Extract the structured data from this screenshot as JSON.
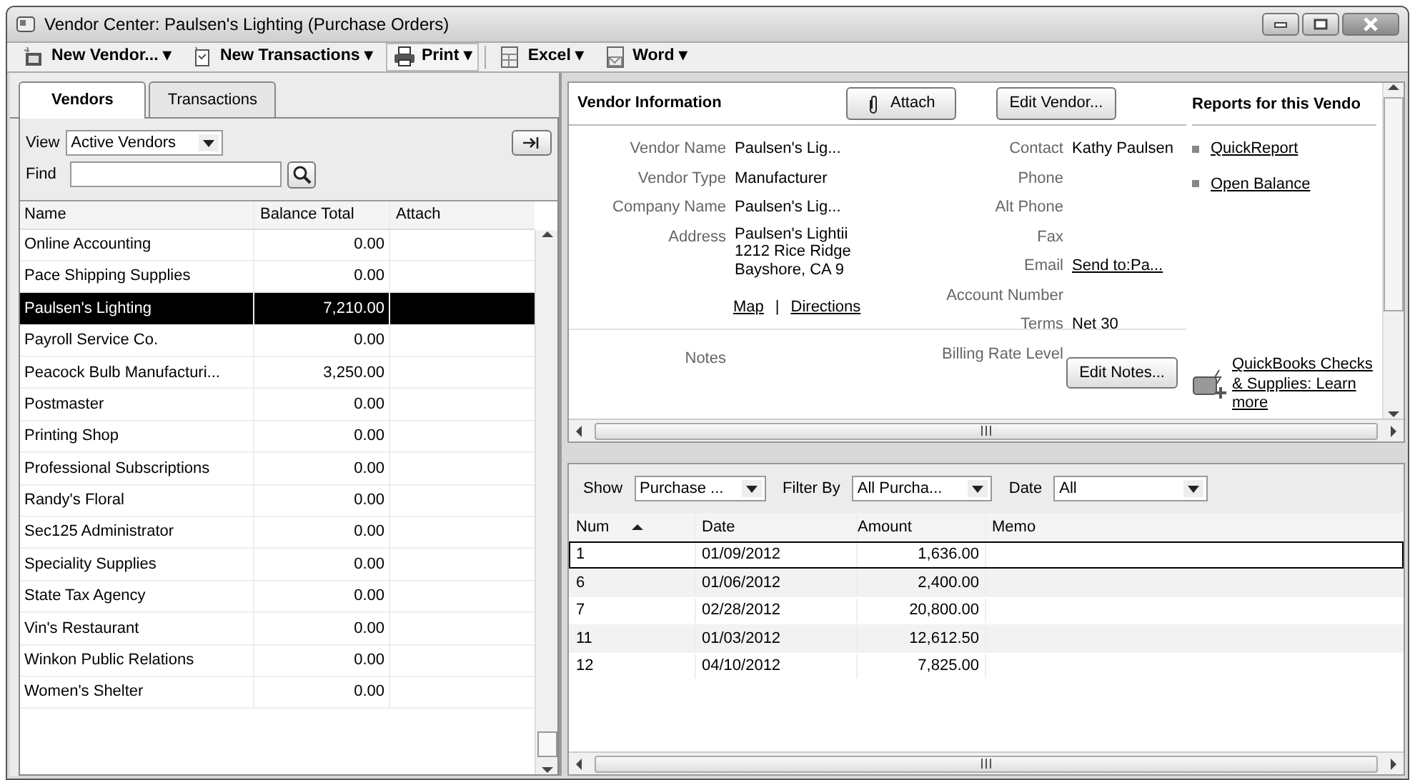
{
  "window": {
    "title": "Vendor Center: Paulsen's Lighting (Purchase Orders)"
  },
  "toolbar": [
    {
      "label": "New Vendor...",
      "caret": "▾"
    },
    {
      "label": "New Transactions",
      "caret": "▾"
    },
    {
      "label": "Print",
      "caret": "▾"
    },
    {
      "label": "Excel",
      "caret": "▾"
    },
    {
      "label": "Word",
      "caret": "▾"
    }
  ],
  "tabs": [
    {
      "label": "Vendors",
      "selected": true
    },
    {
      "label": "Transactions",
      "selected": false
    }
  ],
  "view": {
    "label": "View",
    "value": "Active Vendors"
  },
  "find": {
    "label": "Find"
  },
  "vendor_list": {
    "columns": [
      "Name",
      "Balance Total",
      "Attach"
    ],
    "rows": [
      {
        "name": "Online Accounting",
        "balance": "0.00",
        "selected": false
      },
      {
        "name": "Pace Shipping Supplies",
        "balance": "0.00",
        "selected": false
      },
      {
        "name": "Paulsen's Lighting",
        "balance": "7,210.00",
        "selected": true
      },
      {
        "name": "Payroll Service Co.",
        "balance": "0.00",
        "selected": false
      },
      {
        "name": "Peacock Bulb Manufacturi...",
        "balance": "3,250.00",
        "selected": false
      },
      {
        "name": "Postmaster",
        "balance": "0.00",
        "selected": false
      },
      {
        "name": "Printing Shop",
        "balance": "0.00",
        "selected": false
      },
      {
        "name": "Professional Subscriptions",
        "balance": "0.00",
        "selected": false
      },
      {
        "name": "Randy's Floral",
        "balance": "0.00",
        "selected": false
      },
      {
        "name": "Sec125 Administrator",
        "balance": "0.00",
        "selected": false
      },
      {
        "name": "Speciality Supplies",
        "balance": "0.00",
        "selected": false
      },
      {
        "name": "State Tax Agency",
        "balance": "0.00",
        "selected": false
      },
      {
        "name": "Vin's Restaurant",
        "balance": "0.00",
        "selected": false
      },
      {
        "name": "Winkon Public Relations",
        "balance": "0.00",
        "selected": false
      },
      {
        "name": "Women's Shelter",
        "balance": "0.00",
        "selected": false
      }
    ]
  },
  "vendor_info": {
    "title": "Vendor Information",
    "attach_button": "Attach",
    "edit_button": "Edit Vendor...",
    "left_fields": [
      {
        "label": "Vendor Name",
        "value": "Paulsen's Lig..."
      },
      {
        "label": "Vendor Type",
        "value": "Manufacturer"
      },
      {
        "label": "Company Name",
        "value": "Paulsen's Lig..."
      }
    ],
    "address": {
      "label": "Address",
      "lines": [
        "Paulsen's Lightii",
        "1212 Rice Ridge",
        "Bayshore, CA 9"
      ]
    },
    "links": [
      "Map",
      "Directions"
    ],
    "link_separator": "|",
    "right_fields": [
      {
        "label": "Contact",
        "value": "Kathy Paulsen",
        "kind": "text"
      },
      {
        "label": "Phone"
      },
      {
        "label": "Alt Phone"
      },
      {
        "label": "Fax"
      },
      {
        "label": "Email",
        "value": "Send to:Pa...",
        "kind": "link"
      },
      {
        "label": "Account Number"
      },
      {
        "label": "Terms",
        "value": "Net 30",
        "kind": "text"
      },
      {
        "label": "Billing Rate Level"
      }
    ],
    "notes_label": "Notes",
    "notes_button": "Edit Notes..."
  },
  "reports": {
    "title": "Reports for this Vendo",
    "links": [
      "QuickReport",
      "Open Balance"
    ],
    "promo": "QuickBooks Checks & Supplies: Learn more"
  },
  "transactions": {
    "filters": [
      {
        "label": "Show",
        "value": "Purchase ..."
      },
      {
        "label": "Filter By",
        "value": "All Purcha..."
      },
      {
        "label": "Date",
        "value": "All"
      }
    ],
    "columns": [
      {
        "label": "Num",
        "sorted": true
      },
      {
        "label": "Date",
        "sorted": false
      },
      {
        "label": "Amount",
        "sorted": false
      },
      {
        "label": "Memo",
        "sorted": false
      }
    ],
    "rows": [
      {
        "num": "1",
        "date": "01/09/2012",
        "amount": "1,636.00",
        "selected": true
      },
      {
        "num": "6",
        "date": "01/06/2012",
        "amount": "2,400.00",
        "selected": false
      },
      {
        "num": "7",
        "date": "02/28/2012",
        "amount": "20,800.00",
        "selected": false
      },
      {
        "num": "11",
        "date": "01/03/2012",
        "amount": "12,612.50",
        "selected": false
      },
      {
        "num": "12",
        "date": "04/10/2012",
        "amount": "7,825.00",
        "selected": false
      }
    ]
  }
}
